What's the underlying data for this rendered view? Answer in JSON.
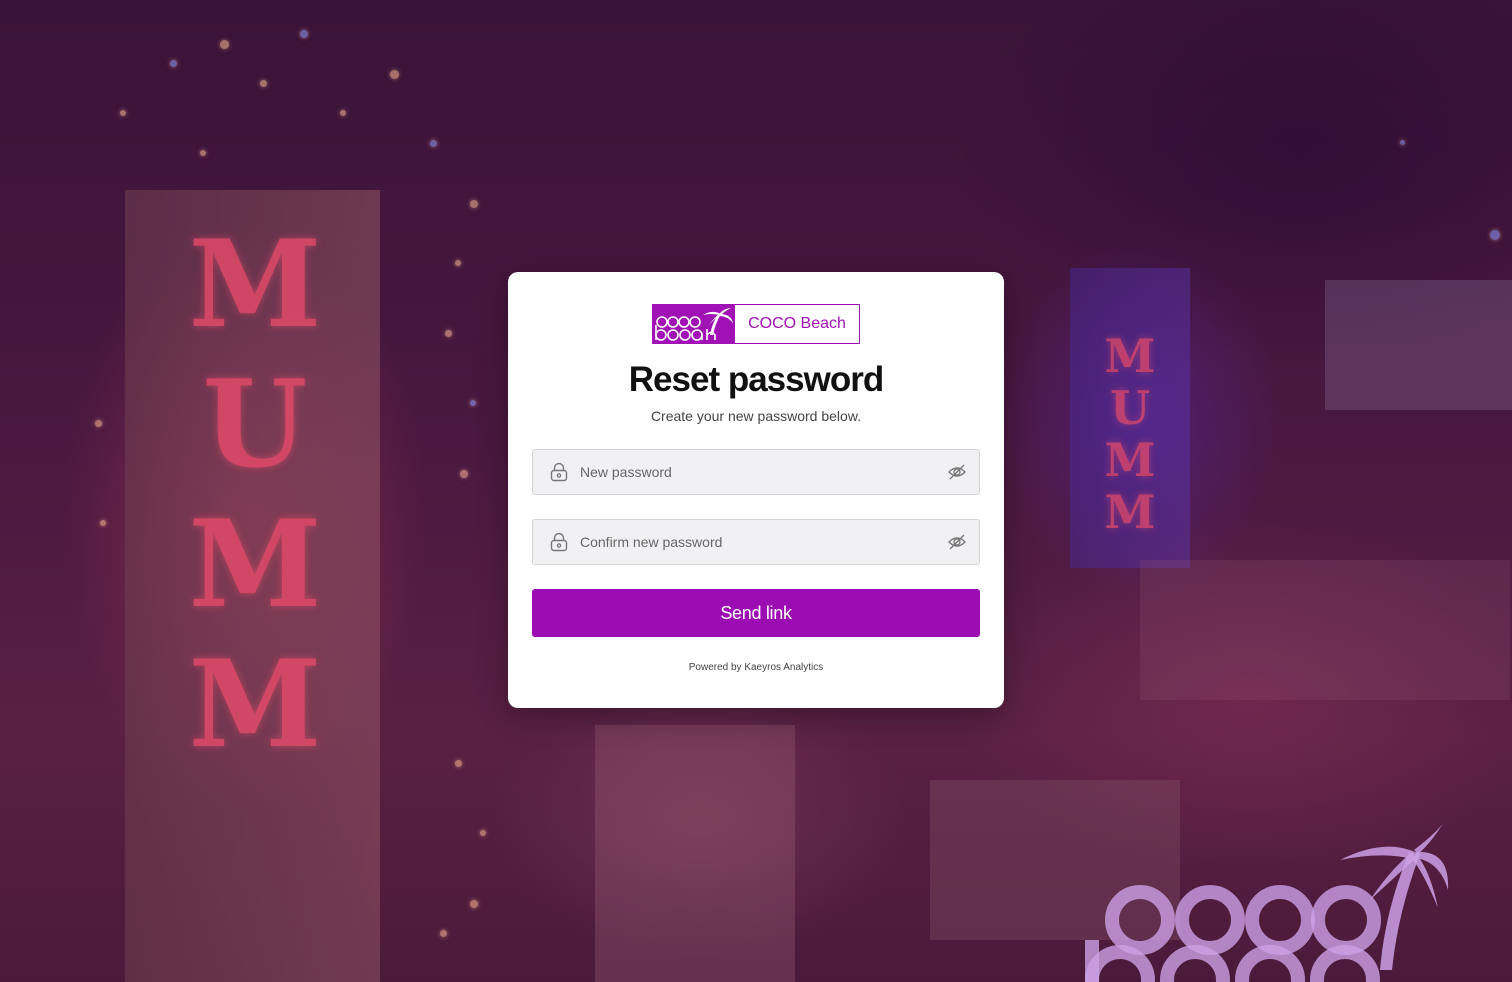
{
  "brand": {
    "logo_mark_text_top": "coco",
    "logo_mark_text_bottom": "beach",
    "name": "COCO Beach",
    "color": "#a012b3"
  },
  "background": {
    "neon_sign_text": "MUMM",
    "watermark_top": "coco",
    "watermark_bottom": "beach"
  },
  "form": {
    "title": "Reset password",
    "subtitle": "Create your new password below.",
    "new_password": {
      "placeholder": "New password",
      "value": "",
      "icon": "lock-icon",
      "toggle_icon": "eye-off-icon"
    },
    "confirm_password": {
      "placeholder": "Confirm new password",
      "value": "",
      "icon": "lock-icon",
      "toggle_icon": "eye-off-icon"
    },
    "submit_label": "Send link",
    "accent_color": "#9c0cb3"
  },
  "footer": {
    "powered_by": "Powered by Kaeyros Analytics"
  }
}
